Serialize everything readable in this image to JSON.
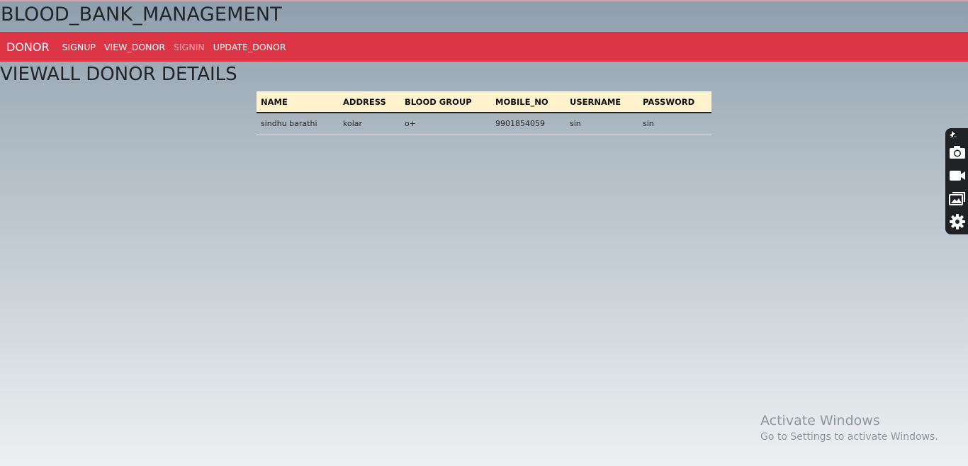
{
  "app": {
    "title": "BLOOD_BANK_MANAGEMENT"
  },
  "navbar": {
    "brand": "DONOR",
    "links": [
      {
        "label": "SIGNUP",
        "active": false
      },
      {
        "label": "VIEW_DONOR",
        "active": false
      },
      {
        "label": "SIGNIN",
        "active": true
      },
      {
        "label": "UPDATE_DONOR",
        "active": false
      }
    ],
    "color": "#dc3545"
  },
  "main": {
    "heading": "VIEWALL DONOR DETAILS",
    "table": {
      "columns": [
        "NAME",
        "ADDRESS",
        "BLOOD GROUP",
        "MOBILE_NO",
        "USERNAME",
        "PASSWORD"
      ],
      "rows": [
        [
          "sindhu barathi",
          "kolar",
          "o+",
          "9901854059",
          "sin",
          "sin"
        ]
      ],
      "header_color": "#fff2cc"
    }
  },
  "watermark": {
    "title": "Activate Windows",
    "subtitle": "Go to Settings to activate Windows."
  },
  "tool_panel": {
    "icons": [
      "pin-icon",
      "camera-icon",
      "video-icon",
      "gallery-icon",
      "gear-icon"
    ]
  }
}
